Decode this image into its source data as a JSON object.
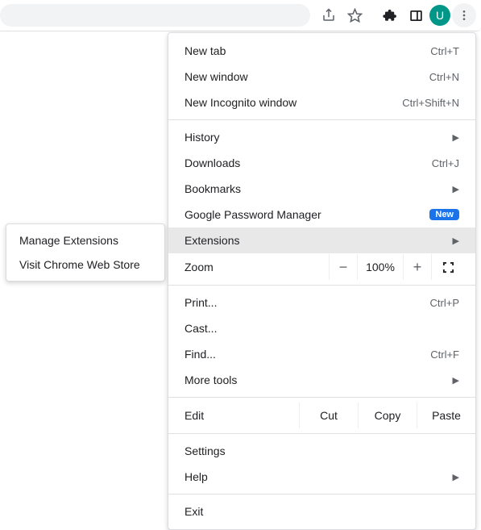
{
  "toolbar": {
    "avatar_letter": "U"
  },
  "submenu": {
    "manage": "Manage Extensions",
    "store": "Visit Chrome Web Store"
  },
  "menu": {
    "new_tab": "New tab",
    "new_tab_sc": "Ctrl+T",
    "new_win": "New window",
    "new_win_sc": "Ctrl+N",
    "incog": "New Incognito window",
    "incog_sc": "Ctrl+Shift+N",
    "history": "History",
    "downloads": "Downloads",
    "downloads_sc": "Ctrl+J",
    "bookmarks": "Bookmarks",
    "pw_mgr": "Google Password Manager",
    "pw_badge": "New",
    "extensions": "Extensions",
    "zoom": "Zoom",
    "zoom_val": "100%",
    "print": "Print...",
    "print_sc": "Ctrl+P",
    "cast": "Cast...",
    "find": "Find...",
    "find_sc": "Ctrl+F",
    "more_tools": "More tools",
    "edit": "Edit",
    "cut": "Cut",
    "copy": "Copy",
    "paste": "Paste",
    "settings": "Settings",
    "help": "Help",
    "exit": "Exit"
  }
}
